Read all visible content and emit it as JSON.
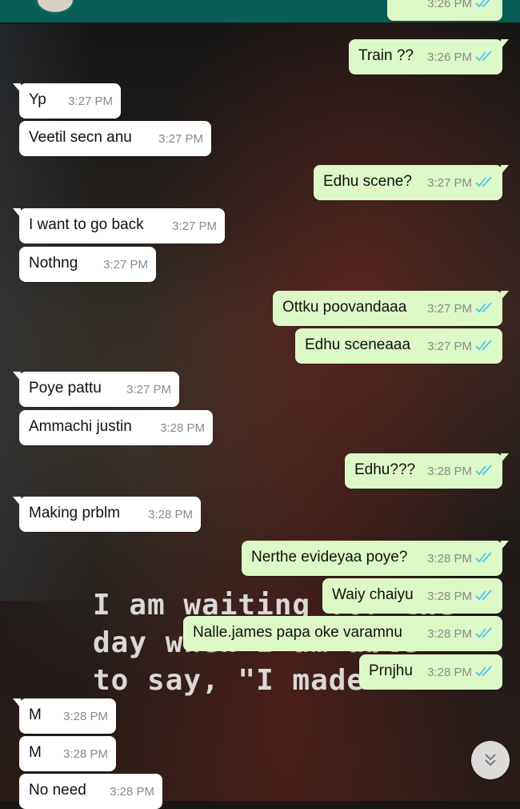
{
  "header": {
    "avatar_alt": "contact avatar"
  },
  "wallpaper": {
    "quote_lines": [
      "I am waiting for the",
      "day when I am able",
      "to say, \"I made it\""
    ]
  },
  "messages": [
    {
      "dir": "out",
      "text": "",
      "time": "3:26 PM",
      "read": true,
      "partial": true
    },
    {
      "dir": "out",
      "text": "Train ??",
      "time": "3:26 PM",
      "read": true
    },
    {
      "dir": "in",
      "text": "Yp",
      "time": "3:27 PM"
    },
    {
      "dir": "in",
      "text": "Veetil secn anu",
      "time": "3:27 PM"
    },
    {
      "dir": "out",
      "text": "Edhu scene?",
      "time": "3:27 PM",
      "read": true
    },
    {
      "dir": "in",
      "text": "I want to go back",
      "time": "3:27 PM"
    },
    {
      "dir": "in",
      "text": "Nothng",
      "time": "3:27 PM"
    },
    {
      "dir": "out",
      "text": "Ottku poovandaaa",
      "time": "3:27 PM",
      "read": true
    },
    {
      "dir": "out",
      "text": "Edhu sceneaaa",
      "time": "3:27 PM",
      "read": true
    },
    {
      "dir": "in",
      "text": "Poye pattu",
      "time": "3:27 PM"
    },
    {
      "dir": "in",
      "text": "Ammachi justin",
      "time": "3:28 PM"
    },
    {
      "dir": "out",
      "text": "Edhu???",
      "time": "3:28 PM",
      "read": true
    },
    {
      "dir": "in",
      "text": "Making prblm",
      "time": "3:28 PM"
    },
    {
      "dir": "out",
      "text": "Nerthe evideyaa poye?",
      "time": "3:28 PM",
      "read": true
    },
    {
      "dir": "out",
      "text": "Waiy chaiyu",
      "time": "3:28 PM",
      "read": true
    },
    {
      "dir": "out",
      "text": "Nalle.james papa oke varamnu",
      "time": "3:28 PM",
      "read": true
    },
    {
      "dir": "out",
      "text": "Prnjhu",
      "time": "3:28 PM",
      "read": true
    },
    {
      "dir": "in",
      "text": "M",
      "time": "3:28 PM"
    },
    {
      "dir": "in",
      "text": "M",
      "time": "3:28 PM"
    },
    {
      "dir": "in",
      "text": "No need",
      "time": "3:28 PM"
    }
  ],
  "scroll_button": {
    "icon": "double-chevron-down-icon"
  },
  "colors": {
    "header": "#075e54",
    "incoming": "#ffffff",
    "outgoing": "#dcf8c6",
    "read_ticks": "#4fc3f7"
  }
}
